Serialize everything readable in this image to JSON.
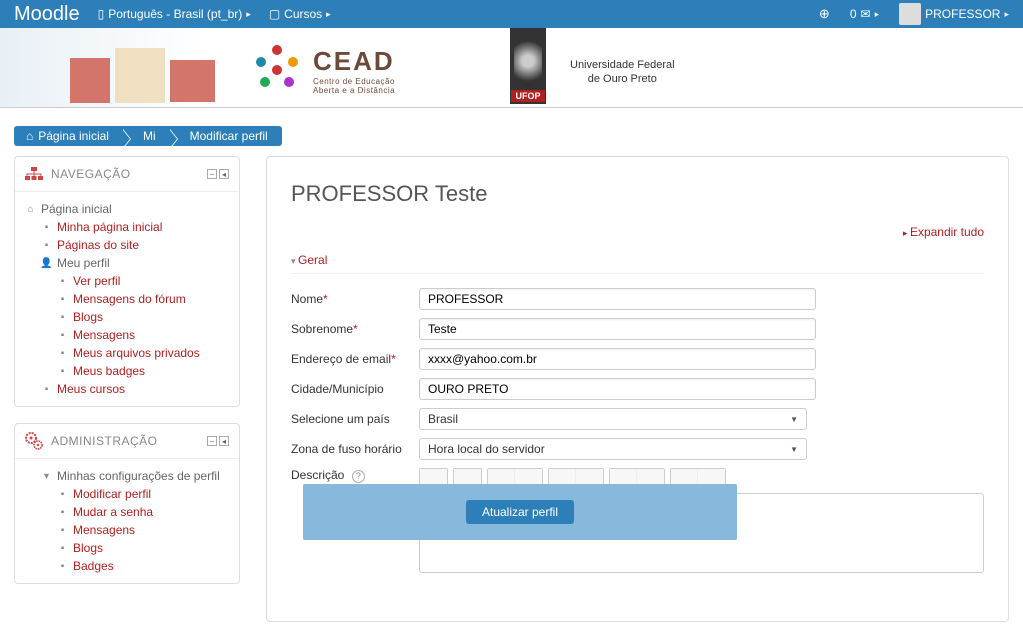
{
  "navbar": {
    "brand": "Moodle",
    "language": "Português - Brasil (pt_br)",
    "courses": "Cursos",
    "msg_count": "0",
    "username": "PROFESSOR"
  },
  "banner": {
    "cead_title": "CEAD",
    "cead_sub1": "Centro de Educação",
    "cead_sub2": "Aberta e a Distância",
    "ufop": "UFOP",
    "uni1": "Universidade Federal",
    "uni2": "de Ouro Preto"
  },
  "breadcrumb": {
    "home": "Página inicial",
    "mid": "Mi",
    "last": "Modificar perfil"
  },
  "nav_block": {
    "title": "NAVEGAÇÃO",
    "items": {
      "home": "Página inicial",
      "myhome": "Minha página inicial",
      "site": "Páginas do site",
      "profile": "Meu perfil",
      "view": "Ver perfil",
      "forum": "Mensagens do fórum",
      "blogs": "Blogs",
      "messages": "Mensagens",
      "private": "Meus arquivos privados",
      "badges": "Meus badges",
      "courses": "Meus cursos"
    }
  },
  "admin_block": {
    "title": "ADMINISTRAÇÃO",
    "items": {
      "settings": "Minhas configurações de perfil",
      "edit": "Modificar perfil",
      "pwd": "Mudar a senha",
      "msg": "Mensagens",
      "blogs": "Blogs",
      "badges": "Badges"
    }
  },
  "main": {
    "title": "PROFESSOR Teste",
    "expand": "Expandir tudo",
    "section_general": "Geral",
    "labels": {
      "firstname": "Nome",
      "lastname": "Sobrenome",
      "email": "Endereço de email",
      "city": "Cidade/Município",
      "country": "Selecione um país",
      "timezone": "Zona de fuso horário",
      "description": "Descrição"
    },
    "values": {
      "firstname": "PROFESSOR",
      "lastname": "Teste",
      "email": "xxxx@yahoo.com.br",
      "city": "OURO PRETO",
      "country": "Brasil",
      "timezone": "Hora local do servidor"
    }
  },
  "modal": {
    "button": "Atualizar perfil"
  }
}
